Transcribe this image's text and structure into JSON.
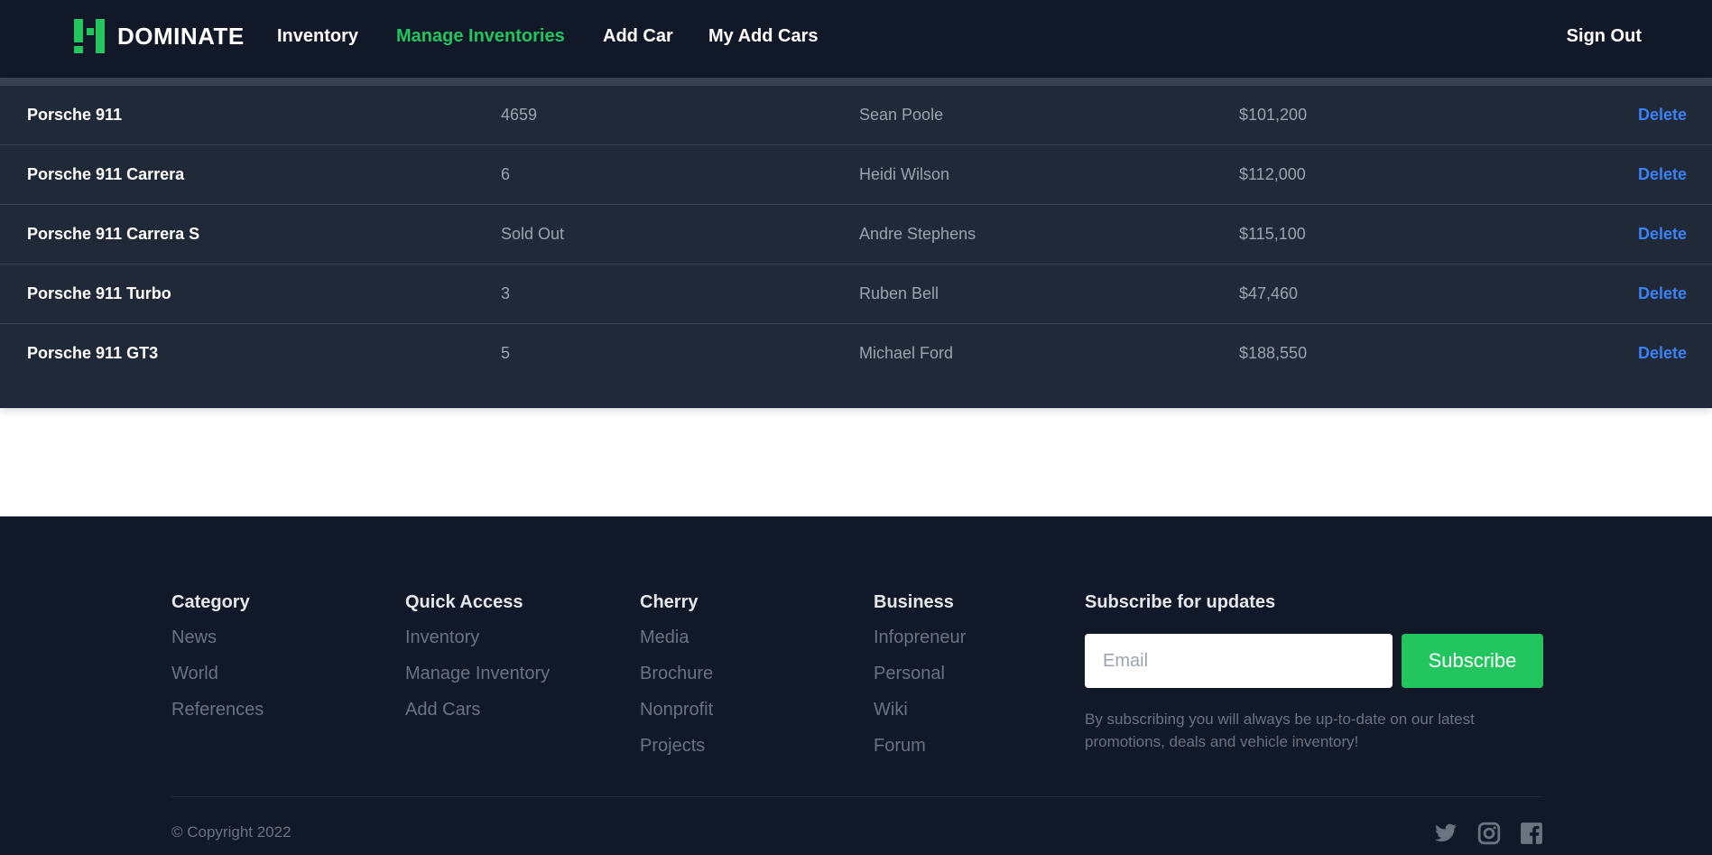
{
  "header": {
    "brand": "DOMINATE",
    "nav": [
      "Inventory",
      "Manage Inventories",
      "Add Car",
      "My Add Cars"
    ],
    "active_nav": "Manage Inventories",
    "sign_out": "Sign Out"
  },
  "table": {
    "rows": [
      {
        "name": "Porsche 911",
        "stock": "4659",
        "owner": "Sean Poole",
        "price": "$101,200",
        "action": "Delete"
      },
      {
        "name": "Porsche 911 Carrera",
        "stock": "6",
        "owner": "Heidi Wilson",
        "price": "$112,000",
        "action": "Delete"
      },
      {
        "name": "Porsche 911 Carrera S",
        "stock": "Sold Out",
        "owner": "Andre Stephens",
        "price": "$115,100",
        "action": "Delete"
      },
      {
        "name": "Porsche 911 Turbo",
        "stock": "3",
        "owner": "Ruben Bell",
        "price": "$47,460",
        "action": "Delete"
      },
      {
        "name": "Porsche 911 GT3",
        "stock": "5",
        "owner": "Michael Ford",
        "price": "$188,550",
        "action": "Delete"
      }
    ]
  },
  "footer": {
    "columns": [
      {
        "title": "Category",
        "links": [
          "News",
          "World",
          "References"
        ]
      },
      {
        "title": "Quick Access",
        "links": [
          "Inventory",
          "Manage Inventory",
          "Add Cars"
        ]
      },
      {
        "title": "Cherry",
        "links": [
          "Media",
          "Brochure",
          "Nonprofit",
          "Projects"
        ]
      },
      {
        "title": "Business",
        "links": [
          "Infopreneur",
          "Personal",
          "Wiki",
          "Forum"
        ]
      }
    ],
    "subscribe": {
      "title": "Subscribe for updates",
      "placeholder": "Email",
      "button": "Subscribe",
      "note": "By subscribing you will always be up-to-date on our latest promotions, deals and vehicle inventory!"
    },
    "copyright": "© Copyright 2022",
    "social_icons": [
      "twitter-icon",
      "instagram-icon",
      "facebook-icon"
    ]
  },
  "colors": {
    "accent": "#22c55e",
    "link": "#3b82f6",
    "navbar_bg": "#111827",
    "table_bg": "#1f2937"
  }
}
